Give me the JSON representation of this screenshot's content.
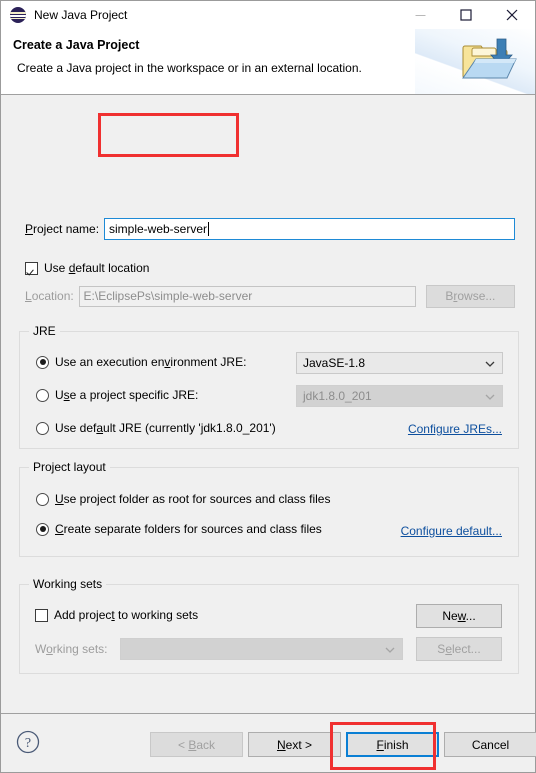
{
  "window": {
    "title": "New Java Project",
    "app_icon": "eclipse-logo-icon",
    "controls": {
      "minimize": "minimize-icon",
      "maximize": "maximize-icon",
      "close": "close-icon"
    }
  },
  "banner": {
    "title": "Create a Java Project",
    "description": "Create a Java project in the workspace or in an external location.",
    "icon": "new-java-project-folder-icon"
  },
  "project_name": {
    "label": "Project name:",
    "label_mnemonic": "P",
    "value": "simple-web-server",
    "placeholder": "",
    "focused": true
  },
  "location": {
    "use_default_label": "Use default location",
    "use_default_mnemonic": "d",
    "use_default_checked": true,
    "label": "Location:",
    "label_mnemonic": "L",
    "value": "E:\\EclipsePs\\simple-web-server",
    "enabled": false,
    "browse_label": "Browse...",
    "browse_mnemonic": "r",
    "browse_enabled": false
  },
  "jre": {
    "group_title": "JRE",
    "options": [
      {
        "label": "Use an execution environment JRE:",
        "mnemonic": "v",
        "selected": true,
        "combo_value": "JavaSE-1.8",
        "combo_enabled": true
      },
      {
        "label": "Use a project specific JRE:",
        "mnemonic": "s",
        "selected": false,
        "combo_value": "jdk1.8.0_201",
        "combo_enabled": false
      },
      {
        "label": "Use default JRE (currently 'jdk1.8.0_201')",
        "mnemonic": "a",
        "selected": false
      }
    ],
    "configure_link": "Configure JREs..."
  },
  "project_layout": {
    "group_title": "Project layout",
    "options": [
      {
        "label": "Use project folder as root for sources and class files",
        "mnemonic": "U",
        "selected": false
      },
      {
        "label": "Create separate folders for sources and class files",
        "mnemonic": "C",
        "selected": true
      }
    ],
    "configure_link": "Configure default..."
  },
  "working_sets": {
    "group_title": "Working sets",
    "add_label": "Add project to working sets",
    "add_mnemonic": "t",
    "add_checked": false,
    "sets_label": "Working sets:",
    "sets_mnemonic": "o",
    "sets_value": "",
    "sets_enabled": false,
    "new_label": "New...",
    "new_mnemonic": "w",
    "select_label": "Select...",
    "select_mnemonic": "e",
    "select_enabled": false
  },
  "footer": {
    "help_icon": "help-question-icon",
    "buttons": [
      {
        "label": "< Back",
        "mnemonic": "B",
        "enabled": false
      },
      {
        "label": "Next >",
        "mnemonic": "N",
        "enabled": true
      },
      {
        "label": "Finish",
        "mnemonic": "F",
        "enabled": true,
        "focused": true
      },
      {
        "label": "Cancel",
        "mnemonic": "",
        "enabled": true
      }
    ]
  },
  "annotations": {
    "highlight_color": "#f03030",
    "focus_color": "#0a7fd4",
    "targets": [
      "project-name-input",
      "finish-button"
    ]
  }
}
